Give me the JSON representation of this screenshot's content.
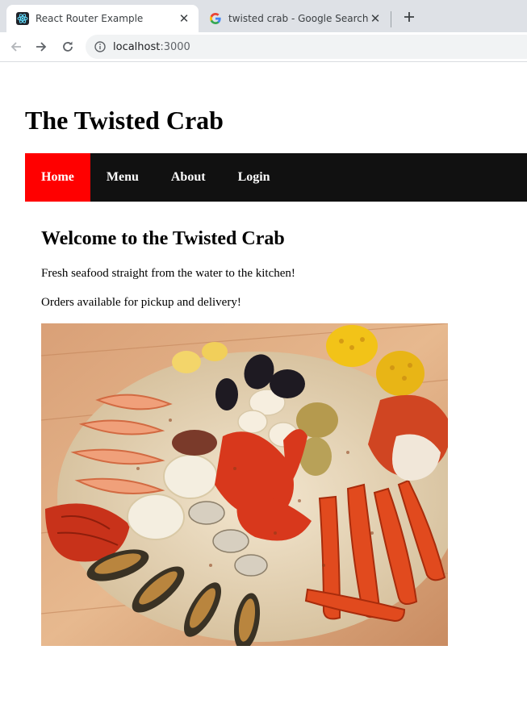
{
  "browser": {
    "tabs": [
      {
        "title": "React Router Example",
        "active": true,
        "favicon": "react-icon"
      },
      {
        "title": "twisted crab - Google Search",
        "active": false,
        "favicon": "google-icon"
      }
    ],
    "address": {
      "host": "localhost",
      "port": ":3000"
    }
  },
  "site": {
    "title": "The Twisted Crab"
  },
  "nav": {
    "items": [
      {
        "label": "Home",
        "active": true
      },
      {
        "label": "Menu",
        "active": false
      },
      {
        "label": "About",
        "active": false
      },
      {
        "label": "Login",
        "active": false
      }
    ],
    "active_color": "#ff0000",
    "bar_color": "#111111"
  },
  "main": {
    "heading": "Welcome to the Twisted Crab",
    "tagline": "Fresh seafood straight from the water to the kitchen!",
    "orders": "Orders available for pickup and delivery!",
    "image": "seafood-boil-platter"
  }
}
